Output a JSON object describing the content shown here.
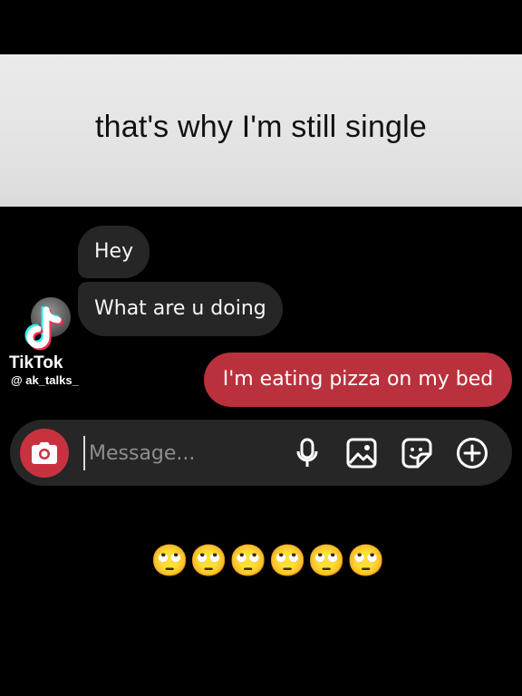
{
  "overlay": {
    "caption": "that's why I'm still single",
    "emoji_reaction": "🙄🙄🙄🙄🙄🙄"
  },
  "watermark": {
    "brand": "TikTok",
    "handle": "@ ak_talks_",
    "logo_icon": "tiktok-note-icon"
  },
  "conversation": {
    "messages": [
      {
        "from": "other",
        "text": "Hey"
      },
      {
        "from": "other",
        "text": "What are u doing"
      },
      {
        "from": "me",
        "text": "I'm eating pizza on my bed"
      }
    ]
  },
  "composer": {
    "placeholder": "Message...",
    "value": "",
    "icons": [
      "camera-icon",
      "microphone-icon",
      "gallery-icon",
      "sticker-icon",
      "plus-icon"
    ]
  },
  "colors": {
    "background": "#000000",
    "incoming_bubble": "#262626",
    "outgoing_bubble": "#b9313d",
    "camera_button": "#c8323f",
    "caption_banner": "#e6e6e6"
  }
}
